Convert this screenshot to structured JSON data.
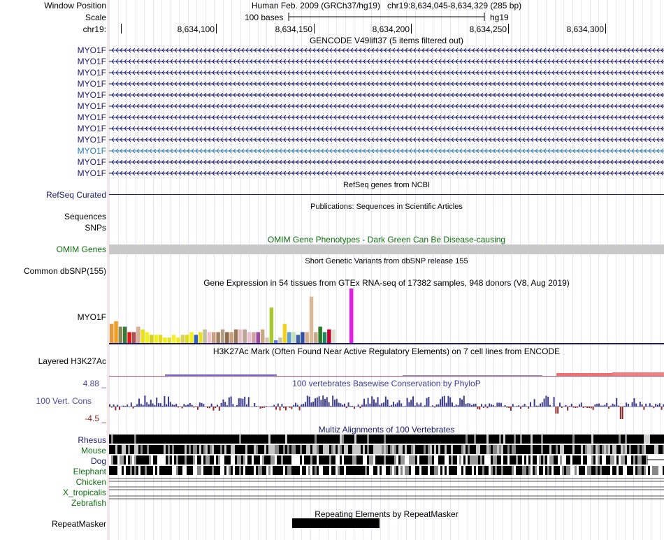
{
  "header": {
    "window_position_label": "Window Position",
    "window_position_value": "Human Feb. 2009 (GRCh37/hg19)   chr19:8,634,045-8,634,329 (285 bp)",
    "scale_label": "Scale",
    "scale_bar_label": "100 bases",
    "assembly": "hg19",
    "chrom_label": "chr19:",
    "ruler_ticks": [
      {
        "label": "8,634,100",
        "pos": 8634100
      },
      {
        "label": "8,634,150",
        "pos": 8634150
      },
      {
        "label": "8,634,200",
        "pos": 8634200
      },
      {
        "label": "8,634,250",
        "pos": 8634250
      },
      {
        "label": "8,634,300",
        "pos": 8634300
      }
    ]
  },
  "tracks": {
    "gencode": {
      "title": "GENCODE V49lift37 (5 items filtered out)",
      "items": [
        "MYO1F",
        "MYO1F",
        "MYO1F",
        "MYO1F",
        "MYO1F",
        "MYO1F",
        "MYO1F",
        "MYO1F",
        "MYO1F",
        "MYO1F",
        "MYO1F",
        "MYO1F"
      ],
      "highlighted_index": 9,
      "color": "#1a1a6e",
      "highlight_color": "#2a7ab0"
    },
    "refseq": {
      "label": "RefSeq Curated",
      "title": "RefSeq genes from NCBI"
    },
    "publications": {
      "title": "Publications: Sequences in Scientific Articles",
      "labels": [
        "Sequences",
        "SNPs"
      ]
    },
    "omim": {
      "label": "OMIM Genes",
      "title": "OMIM Gene Phenotypes - Dark Green Can Be Disease-causing",
      "bar_color": "#c8c8c8"
    },
    "dbsnp": {
      "label": "Common dbSNP(155)",
      "title": "Short Genetic Variants from dbSNP release 155"
    },
    "gtex": {
      "title": "Gene Expression in 54 tissues from GTEx RNA-seq of 17382 samples, 948 donors (V8, Aug 2019)",
      "label": "MYO1F",
      "values": [
        7,
        8,
        6,
        6,
        4,
        4,
        6,
        5,
        4,
        3,
        3,
        3,
        2,
        2,
        3,
        2,
        3,
        3,
        4,
        3,
        4,
        5,
        4,
        4,
        4,
        5,
        4,
        4,
        5,
        5,
        5,
        4,
        4,
        4,
        5,
        2,
        13,
        1,
        2,
        7,
        4,
        4,
        3,
        4,
        4,
        17,
        4,
        6,
        4,
        5,
        5,
        0,
        0,
        0,
        20
      ],
      "colors": [
        "#e89a3a",
        "#f0a020",
        "#8a8a5a",
        "#3a7a3a",
        "#e01818",
        "#b05050",
        "#d8b098",
        "#e8e020",
        "#f0f020",
        "#d8d020",
        "#f0f020",
        "#e8d820",
        "#f0f018",
        "#e0e030",
        "#f8f030",
        "#f0e820",
        "#d8d060",
        "#e0e020",
        "#f0f020",
        "#3060c0",
        "#e8e020",
        "#c0c0a0",
        "#f0c0c8",
        "#c8a080",
        "#a08060",
        "#b0a088",
        "#8a6a4a",
        "#c8a080",
        "#9a7a5a",
        "#e8c0c8",
        "#b8a898",
        "#f0c0d0",
        "#d0a0a0",
        "#9a4aa0",
        "#c8a880",
        "#d4c8b0",
        "#a8c830",
        "#6080e0",
        "#c8c8a0",
        "#f0d020",
        "#60a0d0",
        "#c0e0c0",
        "#4060b0",
        "#3050a8",
        "#d0b090",
        "#d8b898",
        "#c8a888",
        "#2a7a2a",
        "#208860",
        "#c00030",
        "#e0e0d0",
        "#ffffff",
        "#ffffff",
        "#ffffff",
        "#e020e0"
      ]
    },
    "h3k27ac": {
      "label": "Layered H3K27Ac",
      "title": "H3K27Ac Mark (Often Found Near Active Regulatory Elements) on 7 cell lines from ENCODE"
    },
    "conservation": {
      "label": "100 Vert. Cons",
      "title": "100 vertebrates Basewise Conservation by PhyloP",
      "max_label": "4.88 _",
      "min_label": "-4.5 _",
      "positive_color": "#3a3a8a",
      "negative_color": "#8a2a2a"
    },
    "multiz": {
      "title": "Multiz Alignments of 100 Vertebrates",
      "species": [
        {
          "name": "Rhesus",
          "color": "#1a1a6e"
        },
        {
          "name": "Mouse",
          "color": "#0e6e0e"
        },
        {
          "name": "Dog",
          "color": "#1a1a6e"
        },
        {
          "name": "Elephant",
          "color": "#0e6e0e"
        },
        {
          "name": "Chicken",
          "color": "#0e6e0e"
        },
        {
          "name": "X_tropicalis",
          "color": "#0e6e0e"
        },
        {
          "name": "Zebrafish",
          "color": "#0e6e0e"
        }
      ]
    },
    "repeatmasker": {
      "label": "RepeatMasker",
      "title": "Repeating Elements by RepeatMasker"
    }
  }
}
